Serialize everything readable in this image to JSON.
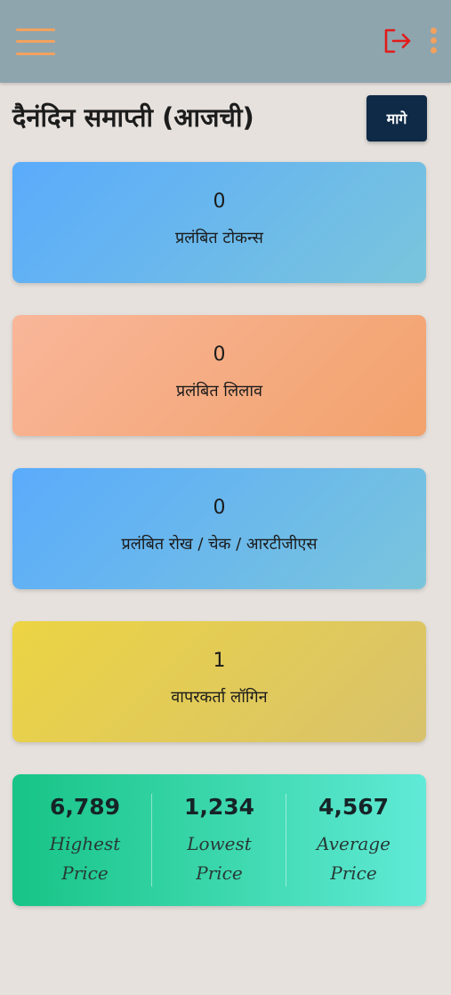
{
  "appbar": {
    "menu_icon": "hamburger-menu-icon",
    "logout_icon": "logout-icon",
    "more_icon": "more-vertical-icon",
    "colors": {
      "bar": "#8ea5ae",
      "menu": "#f3a15e",
      "logout": "#e11b1b"
    }
  },
  "header": {
    "title": "दैनंदिन समाप्ती (आजची)",
    "back_label": "मागे"
  },
  "cards": [
    {
      "count": "0",
      "label": "प्रलंबित टोकन्स"
    },
    {
      "count": "0",
      "label": "प्रलंबित लिलाव"
    },
    {
      "count": "0",
      "label": "प्रलंबित रोख / चेक / आरटीजीएस"
    },
    {
      "count": "1",
      "label": "वापरकर्ता लॉगिन"
    }
  ],
  "prices": [
    {
      "value": "6,789",
      "label_line1": "Highest",
      "label_line2": "Price"
    },
    {
      "value": "1,234",
      "label_line1": "Lowest",
      "label_line2": "Price"
    },
    {
      "value": "4,567",
      "label_line1": "Average",
      "label_line2": "Price"
    }
  ]
}
